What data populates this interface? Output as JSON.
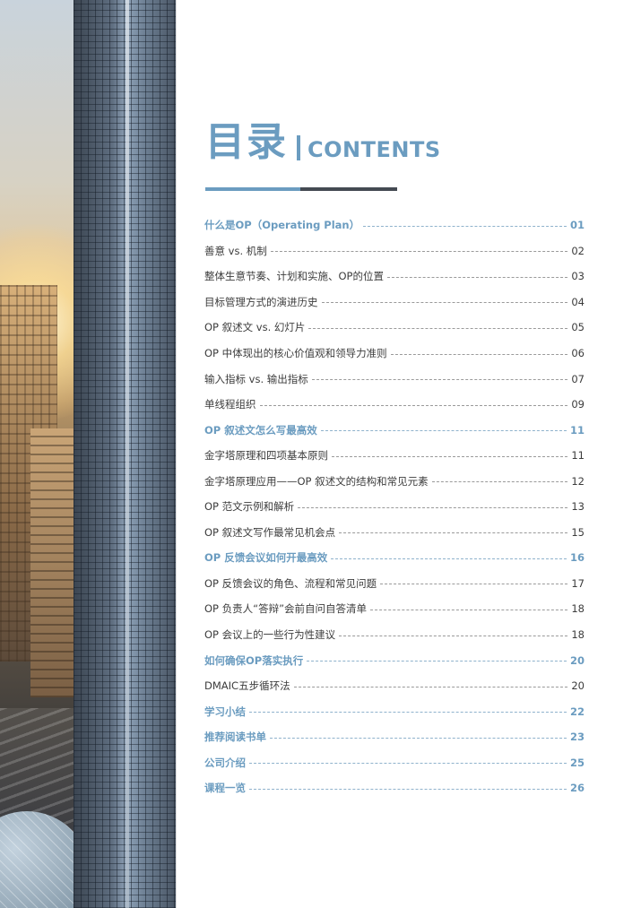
{
  "header": {
    "title_cn": "目录",
    "title_en": "CONTENTS"
  },
  "colors": {
    "accent": "#6b9cc0",
    "dark": "#444a52",
    "text": "#3c3c3c"
  },
  "toc": [
    {
      "label": "什么是OP（Operating Plan）",
      "page": "01",
      "section": true
    },
    {
      "label": "善意 vs. 机制",
      "page": "02",
      "section": false
    },
    {
      "label": "整体生意节奏、计划和实施、OP的位置",
      "page": "03",
      "section": false
    },
    {
      "label": "目标管理方式的演进历史",
      "page": "04",
      "section": false
    },
    {
      "label": "OP 叙述文 vs. 幻灯片",
      "page": "05",
      "section": false
    },
    {
      "label": "OP 中体现出的核心价值观和领导力准则",
      "page": "06",
      "section": false
    },
    {
      "label": "输入指标 vs. 输出指标",
      "page": "07",
      "section": false
    },
    {
      "label": "单线程组织",
      "page": "09",
      "section": false
    },
    {
      "label": "OP 叙述文怎么写最高效",
      "page": "11",
      "section": true
    },
    {
      "label": "金字塔原理和四项基本原则",
      "page": "11",
      "section": false
    },
    {
      "label": "金字塔原理应用——OP 叙述文的结构和常见元素",
      "page": "12",
      "section": false
    },
    {
      "label": "OP 范文示例和解析",
      "page": "13",
      "section": false
    },
    {
      "label": "OP 叙述文写作最常见机会点",
      "page": "15",
      "section": false
    },
    {
      "label": "OP 反馈会议如何开最高效",
      "page": "16",
      "section": true
    },
    {
      "label": "OP 反馈会议的角色、流程和常见问题",
      "page": "17",
      "section": false
    },
    {
      "label": "OP 负责人“答辩”会前自问自答清单",
      "page": "18",
      "section": false
    },
    {
      "label": "OP 会议上的一些行为性建议",
      "page": "18",
      "section": false
    },
    {
      "label": "如何确保OP落实执行",
      "page": "20",
      "section": true
    },
    {
      "label": "DMAIC五步循环法",
      "page": "20",
      "section": false
    },
    {
      "label": "学习小结",
      "page": "22",
      "section": true
    },
    {
      "label": "推荐阅读书单",
      "page": "23",
      "section": true
    },
    {
      "label": "公司介绍",
      "page": "25",
      "section": true
    },
    {
      "label": "课程一览",
      "page": "26",
      "section": true
    }
  ]
}
